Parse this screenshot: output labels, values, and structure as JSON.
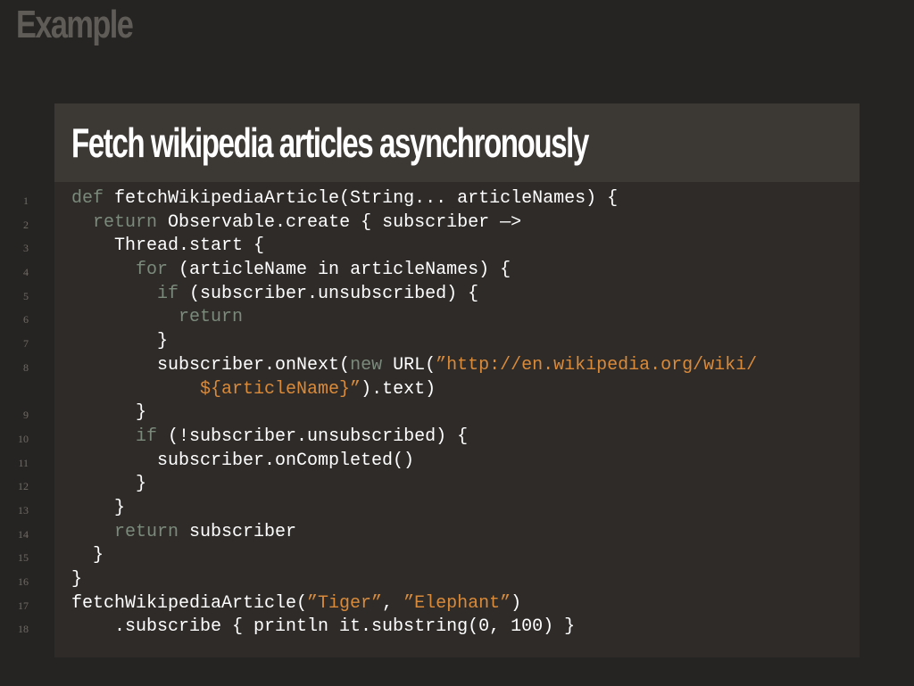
{
  "slide": {
    "title": "Example"
  },
  "panel": {
    "title": "Fetch wikipedia articles asynchronously"
  },
  "code": {
    "lines": [
      {
        "no": "1",
        "segments": [
          {
            "t": "kw",
            "v": "def"
          },
          {
            "t": "txt",
            "v": " fetchWikipediaArticle(String... articleNames) {"
          }
        ]
      },
      {
        "no": "2",
        "segments": [
          {
            "t": "txt",
            "v": "  "
          },
          {
            "t": "kw",
            "v": "return"
          },
          {
            "t": "txt",
            "v": " Observable.create { subscriber —>"
          }
        ]
      },
      {
        "no": "3",
        "segments": [
          {
            "t": "txt",
            "v": "    Thread.start {"
          }
        ]
      },
      {
        "no": "4",
        "segments": [
          {
            "t": "txt",
            "v": "      "
          },
          {
            "t": "kw",
            "v": "for"
          },
          {
            "t": "txt",
            "v": " (articleName in articleNames) {"
          }
        ]
      },
      {
        "no": "5",
        "segments": [
          {
            "t": "txt",
            "v": "        "
          },
          {
            "t": "kw",
            "v": "if"
          },
          {
            "t": "txt",
            "v": " (subscriber.unsubscribed) {"
          }
        ]
      },
      {
        "no": "6",
        "segments": [
          {
            "t": "txt",
            "v": "          "
          },
          {
            "t": "kw",
            "v": "return"
          }
        ]
      },
      {
        "no": "7",
        "segments": [
          {
            "t": "txt",
            "v": "        }"
          }
        ]
      },
      {
        "no": "8",
        "segments": [
          {
            "t": "txt",
            "v": "        subscriber.onNext("
          },
          {
            "t": "kw",
            "v": "new"
          },
          {
            "t": "txt",
            "v": " URL("
          },
          {
            "t": "str",
            "v": "”http://en.wikipedia.org/wiki/"
          }
        ]
      },
      {
        "no": "",
        "segments": [
          {
            "t": "txt",
            "v": "            "
          },
          {
            "t": "str",
            "v": "${articleName}”"
          },
          {
            "t": "txt",
            "v": ").text)"
          }
        ]
      },
      {
        "no": "9",
        "segments": [
          {
            "t": "txt",
            "v": "      }"
          }
        ]
      },
      {
        "no": "10",
        "segments": [
          {
            "t": "txt",
            "v": "      "
          },
          {
            "t": "kw",
            "v": "if"
          },
          {
            "t": "txt",
            "v": " (!subscriber.unsubscribed) {"
          }
        ]
      },
      {
        "no": "11",
        "segments": [
          {
            "t": "txt",
            "v": "        subscriber.onCompleted()"
          }
        ]
      },
      {
        "no": "12",
        "segments": [
          {
            "t": "txt",
            "v": "      }"
          }
        ]
      },
      {
        "no": "13",
        "segments": [
          {
            "t": "txt",
            "v": "    }"
          }
        ]
      },
      {
        "no": "14",
        "segments": [
          {
            "t": "txt",
            "v": "    "
          },
          {
            "t": "kw",
            "v": "return"
          },
          {
            "t": "txt",
            "v": " subscriber"
          }
        ]
      },
      {
        "no": "15",
        "segments": [
          {
            "t": "txt",
            "v": "  }"
          }
        ]
      },
      {
        "no": "16",
        "segments": [
          {
            "t": "txt",
            "v": "}"
          }
        ]
      },
      {
        "no": "17",
        "segments": [
          {
            "t": "txt",
            "v": "fetchWikipediaArticle("
          },
          {
            "t": "str",
            "v": "”Tiger”"
          },
          {
            "t": "txt",
            "v": ", "
          },
          {
            "t": "str",
            "v": "”Elephant”"
          },
          {
            "t": "txt",
            "v": ")"
          }
        ]
      },
      {
        "no": "18",
        "segments": [
          {
            "t": "txt",
            "v": "    .subscribe { println it.substring(0, 100) }"
          }
        ]
      }
    ]
  },
  "colors": {
    "background": "#262422",
    "panel": "#2e2b28",
    "panel_header": "#3c3834",
    "keyword": "#7b8a7b",
    "string": "#d98a3a",
    "text": "#ffffff",
    "line_number": "#6f6a65"
  }
}
